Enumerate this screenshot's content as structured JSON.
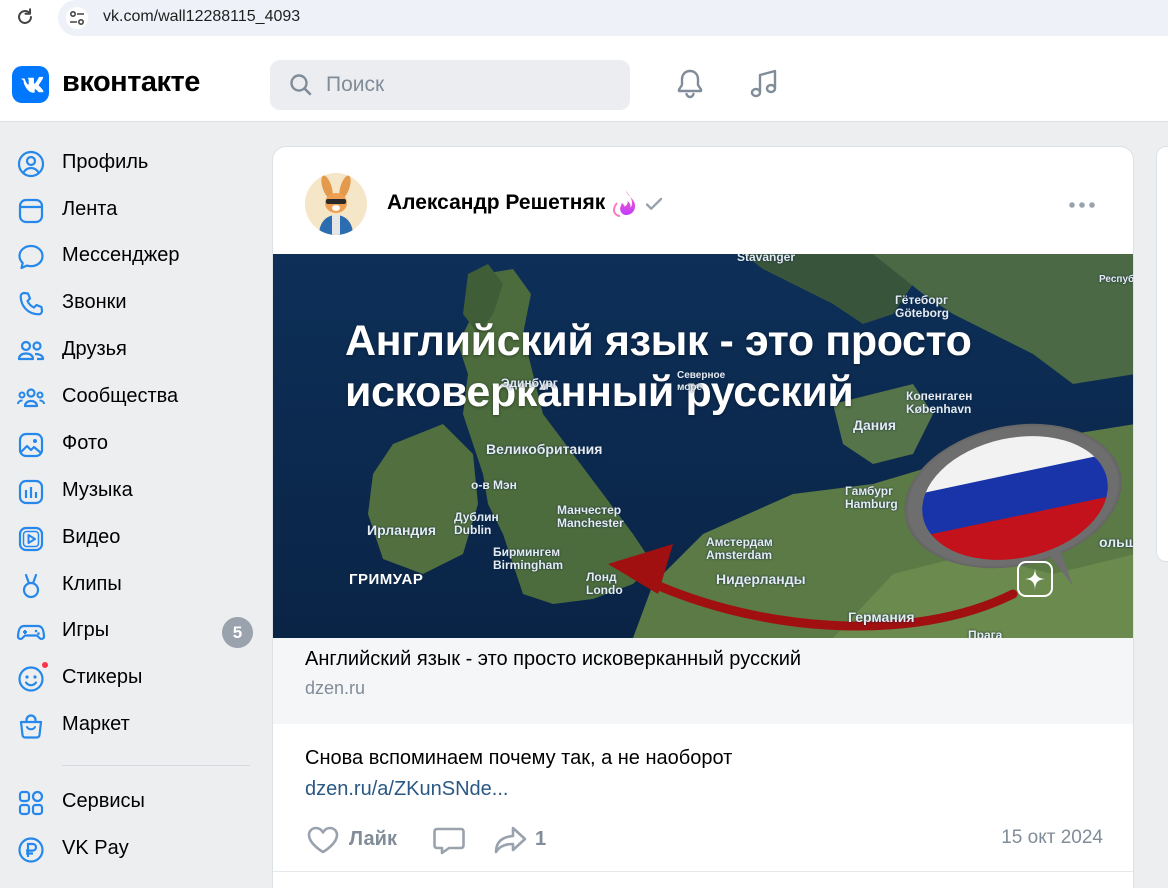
{
  "browser": {
    "url": "vk.com/wall12288115_4093"
  },
  "header": {
    "logo_text": "вконтакте",
    "search_placeholder": "Поиск"
  },
  "sidebar": {
    "items": [
      {
        "label": "Профиль",
        "icon": "profile-icon"
      },
      {
        "label": "Лента",
        "icon": "feed-icon"
      },
      {
        "label": "Мессенджер",
        "icon": "messenger-icon"
      },
      {
        "label": "Звонки",
        "icon": "phone-icon"
      },
      {
        "label": "Друзья",
        "icon": "friends-icon"
      },
      {
        "label": "Сообщества",
        "icon": "communities-icon"
      },
      {
        "label": "Фото",
        "icon": "photo-icon"
      },
      {
        "label": "Музыка",
        "icon": "music-icon"
      },
      {
        "label": "Видео",
        "icon": "video-icon"
      },
      {
        "label": "Клипы",
        "icon": "clips-icon"
      },
      {
        "label": "Игры",
        "icon": "games-icon",
        "badge": "5"
      },
      {
        "label": "Стикеры",
        "icon": "stickers-icon"
      },
      {
        "label": "Маркет",
        "icon": "market-icon"
      },
      {
        "label": "Сервисы",
        "icon": "services-icon"
      },
      {
        "label": "VK Pay",
        "icon": "vkpay-icon"
      }
    ]
  },
  "post": {
    "author": "Александр Решетняк",
    "banner": {
      "title_line1": "Английский язык - это просто",
      "title_line2": "исковерканный русский",
      "watermark": "ГРИМУАР",
      "map_labels": {
        "stavanger": "Stavanger",
        "goteborg": "Гётеборг\nGöteborg",
        "severnoe_more": "Северное\nморе",
        "elinburg": "Эдинбург",
        "kopenhagen": "Копенгаген\nKøbenhavn",
        "dania": "Дания",
        "velikobritania": "Великобритания",
        "o_v_men": "о-в Мэн",
        "dublin": "Дублин\nDublin",
        "irlandia": "Ирландия",
        "manchester": "Манчестер\nManchester",
        "birmingham": "Бирмингем\nBirmingham",
        "london": "Лонд\nLondo",
        "amsterdam": "Амстердам\nAmsterdam",
        "niderlandy": "Нидерланды",
        "gamburg": "Гамбург\nHamburg",
        "germania": "Германия",
        "polsha": "ольша",
        "praga": "Прага",
        "respublica": "Республ"
      }
    },
    "link_title": "Английский язык - это просто исковерканный русский",
    "link_domain": "dzen.ru",
    "text": "Снова вспоминаем почему так, а не наоборот",
    "text_link": "dzen.ru/a/ZKunSNde...",
    "like_label": "Лайк",
    "share_count": "1",
    "date": "15 окт 2024"
  },
  "colors": {
    "vk_blue": "#0077ff",
    "link": "#2a5885",
    "secondary_text": "#818c99",
    "icon_blue": "#2688eb",
    "badge": "#99a2ad"
  }
}
